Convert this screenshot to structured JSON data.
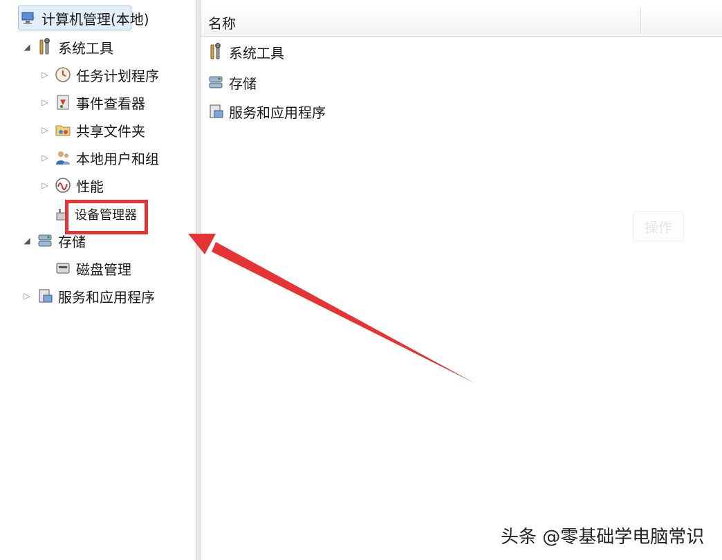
{
  "tree": {
    "root": {
      "label": "计算机管理(本地)"
    },
    "system_tools": {
      "label": "系统工具",
      "children": [
        {
          "label": "任务计划程序"
        },
        {
          "label": "事件查看器"
        },
        {
          "label": "共享文件夹"
        },
        {
          "label": "本地用户和组"
        },
        {
          "label": "性能"
        },
        {
          "label": "设备管理器"
        }
      ]
    },
    "storage": {
      "label": "存储",
      "children": [
        {
          "label": "磁盘管理"
        }
      ]
    },
    "services": {
      "label": "服务和应用程序"
    }
  },
  "list": {
    "column_name": "名称",
    "items": [
      {
        "label": "系统工具",
        "icon": "tools-icon"
      },
      {
        "label": "存储",
        "icon": "storage-icon"
      },
      {
        "label": "服务和应用程序",
        "icon": "services-icon"
      }
    ]
  },
  "faded_button_label": "操作",
  "annotation": {
    "box_color": "#e63434",
    "arrow_color": "#e63434"
  },
  "watermark": "头条 @零基础学电脑常识"
}
